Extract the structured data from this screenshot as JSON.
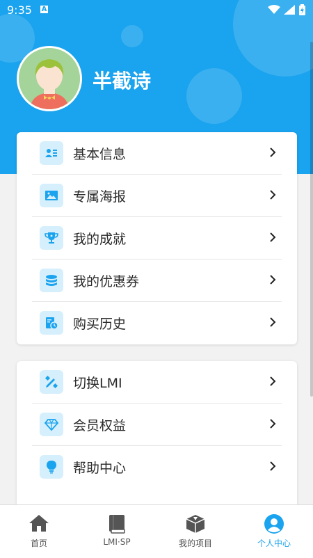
{
  "status_bar": {
    "time": "9:35",
    "notification_icon": "A"
  },
  "profile": {
    "username": "半截诗"
  },
  "menu_group_1": [
    {
      "label": "基本信息",
      "icon": "id-card-icon"
    },
    {
      "label": "专属海报",
      "icon": "image-icon"
    },
    {
      "label": "我的成就",
      "icon": "trophy-icon"
    },
    {
      "label": "我的优惠券",
      "icon": "coins-icon"
    },
    {
      "label": "购买历史",
      "icon": "history-icon"
    }
  ],
  "menu_group_2": [
    {
      "label": "切换LMI",
      "icon": "tools-icon"
    },
    {
      "label": "会员权益",
      "icon": "diamond-icon"
    },
    {
      "label": "帮助中心",
      "icon": "lightbulb-icon"
    }
  ],
  "tabs": [
    {
      "label": "首页",
      "icon": "home-icon",
      "active": false
    },
    {
      "label": "LMI·SP",
      "icon": "book-icon",
      "active": false
    },
    {
      "label": "我的项目",
      "icon": "box-icon",
      "active": false
    },
    {
      "label": "个人中心",
      "icon": "user-icon",
      "active": true
    }
  ],
  "colors": {
    "primary": "#1aa3ee",
    "icon_bg": "#d6effc",
    "page_bg": "#f2f2f2"
  }
}
